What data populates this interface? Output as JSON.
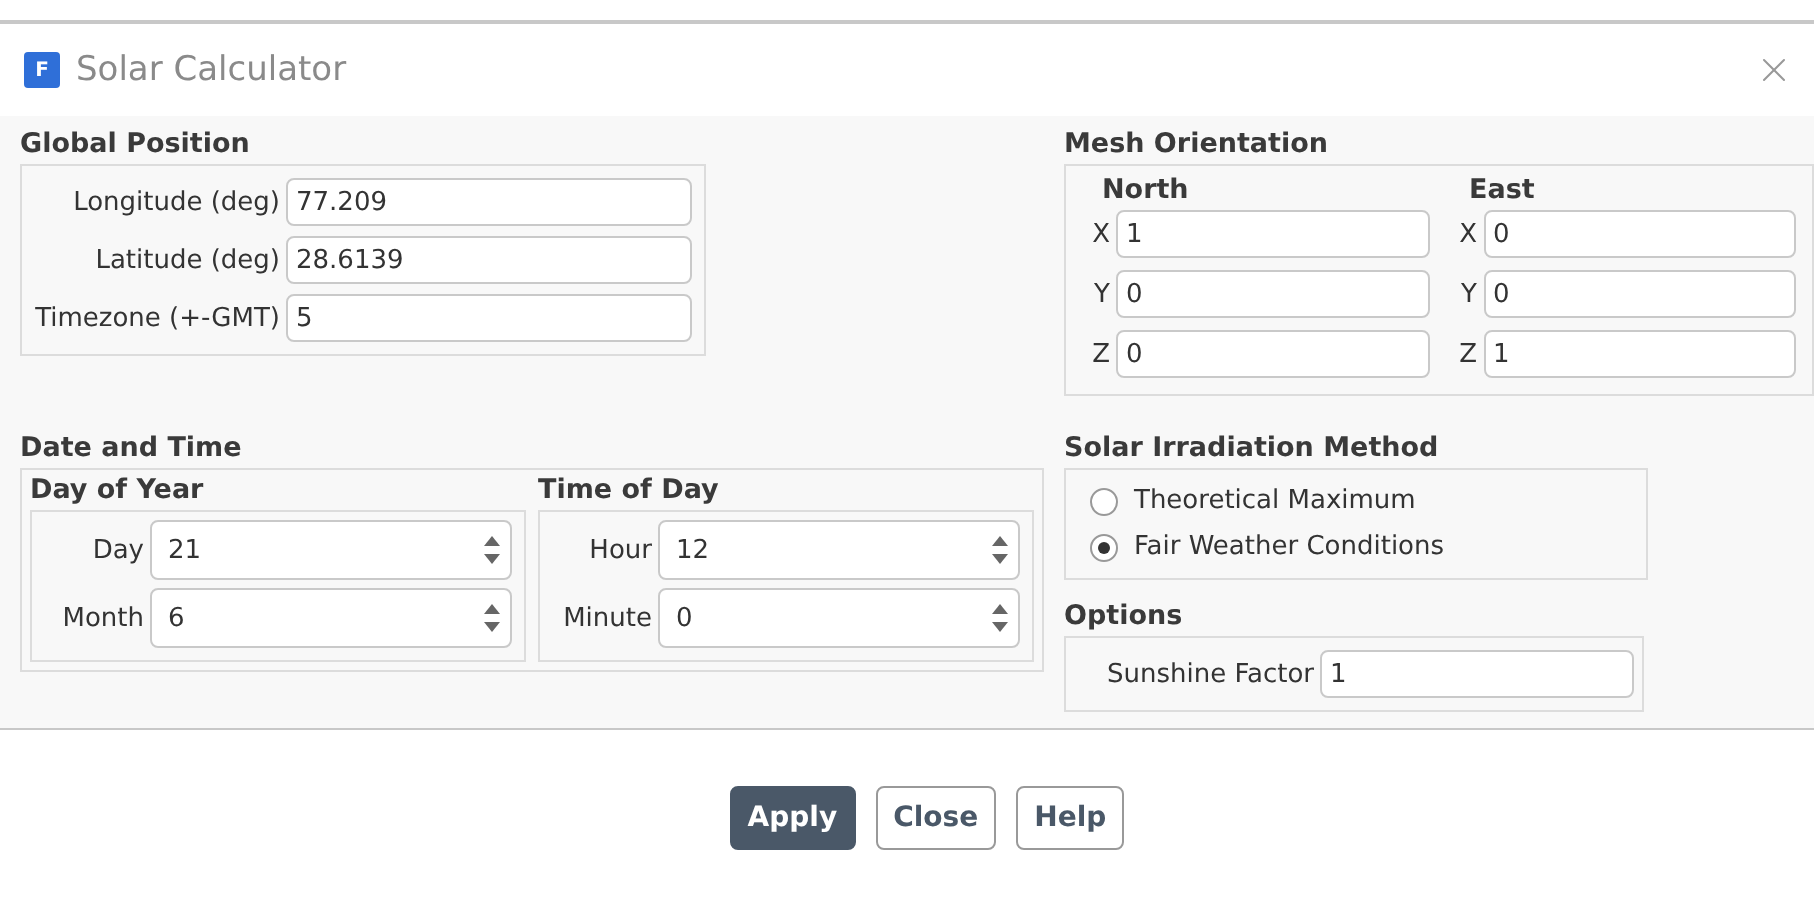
{
  "window": {
    "logo": "F",
    "title": "Solar Calculator"
  },
  "global_position": {
    "title": "Global Position",
    "fields": [
      {
        "label": "Longitude (deg)",
        "value": "77.209"
      },
      {
        "label": "Latitude (deg)",
        "value": "28.6139"
      },
      {
        "label": "Timezone (+-GMT)",
        "value": "5"
      }
    ]
  },
  "mesh_orientation": {
    "title": "Mesh Orientation",
    "groups": [
      {
        "title": "North",
        "fields": [
          {
            "label": "X",
            "value": "1"
          },
          {
            "label": "Y",
            "value": "0"
          },
          {
            "label": "Z",
            "value": "0"
          }
        ]
      },
      {
        "title": "East",
        "fields": [
          {
            "label": "X",
            "value": "0"
          },
          {
            "label": "Y",
            "value": "0"
          },
          {
            "label": "Z",
            "value": "1"
          }
        ]
      }
    ]
  },
  "date_and_time": {
    "title": "Date and Time",
    "groups": [
      {
        "title": "Day of Year",
        "fields": [
          {
            "label": "Day",
            "value": "21"
          },
          {
            "label": "Month",
            "value": "6"
          }
        ]
      },
      {
        "title": "Time of Day",
        "fields": [
          {
            "label": "Hour",
            "value": "12"
          },
          {
            "label": "Minute",
            "value": "0"
          }
        ]
      }
    ]
  },
  "solar_irradiation_method": {
    "title": "Solar Irradiation Method",
    "options": [
      {
        "label": "Theoretical Maximum",
        "selected": false
      },
      {
        "label": "Fair Weather Conditions",
        "selected": true
      }
    ]
  },
  "options": {
    "title": "Options",
    "fields": [
      {
        "label": "Sunshine Factor",
        "value": "1"
      }
    ]
  },
  "buttons": [
    {
      "label": "Apply",
      "primary": true
    },
    {
      "label": "Close",
      "primary": false
    },
    {
      "label": "Help",
      "primary": false
    }
  ]
}
